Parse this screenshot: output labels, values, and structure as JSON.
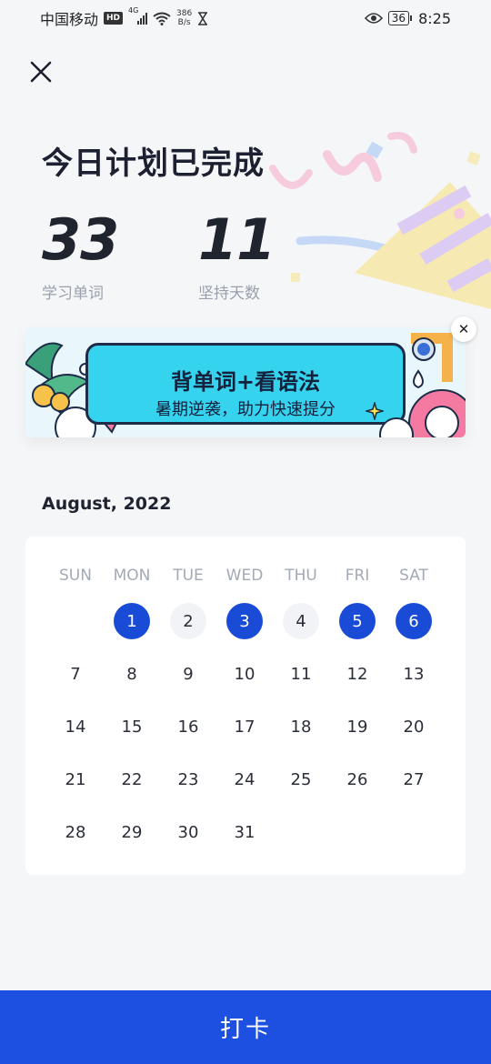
{
  "status_bar": {
    "carrier": "中国移动",
    "hd_badge": "HD",
    "signal_label": "4G",
    "net_speed_value": "386",
    "net_speed_unit": "B/s",
    "battery": "36",
    "time": "8:25"
  },
  "header": {
    "title": "今日计划已完成",
    "stats": [
      {
        "value": "33",
        "label": "学习单词"
      },
      {
        "value": "11",
        "label": "坚持天数"
      }
    ]
  },
  "banner": {
    "title": "背单词+看语法",
    "subtitle": "暑期逆袭，助力快速提分",
    "close_symbol": "✕"
  },
  "calendar": {
    "month_label": "August, 2022",
    "weekdays": [
      "SUN",
      "MON",
      "TUE",
      "WED",
      "THU",
      "FRI",
      "SAT"
    ],
    "leading_blanks": 1,
    "days": [
      {
        "d": "1",
        "state": "done"
      },
      {
        "d": "2",
        "state": "miss"
      },
      {
        "d": "3",
        "state": "done"
      },
      {
        "d": "4",
        "state": "miss"
      },
      {
        "d": "5",
        "state": "done"
      },
      {
        "d": "6",
        "state": "done"
      },
      {
        "d": "7",
        "state": ""
      },
      {
        "d": "8",
        "state": ""
      },
      {
        "d": "9",
        "state": ""
      },
      {
        "d": "10",
        "state": ""
      },
      {
        "d": "11",
        "state": ""
      },
      {
        "d": "12",
        "state": ""
      },
      {
        "d": "13",
        "state": ""
      },
      {
        "d": "14",
        "state": ""
      },
      {
        "d": "15",
        "state": ""
      },
      {
        "d": "16",
        "state": ""
      },
      {
        "d": "17",
        "state": ""
      },
      {
        "d": "18",
        "state": ""
      },
      {
        "d": "19",
        "state": ""
      },
      {
        "d": "20",
        "state": ""
      },
      {
        "d": "21",
        "state": ""
      },
      {
        "d": "22",
        "state": ""
      },
      {
        "d": "23",
        "state": ""
      },
      {
        "d": "24",
        "state": ""
      },
      {
        "d": "25",
        "state": ""
      },
      {
        "d": "26",
        "state": ""
      },
      {
        "d": "27",
        "state": ""
      },
      {
        "d": "28",
        "state": ""
      },
      {
        "d": "29",
        "state": ""
      },
      {
        "d": "30",
        "state": ""
      },
      {
        "d": "31",
        "state": ""
      }
    ]
  },
  "checkin_button": {
    "label": "打卡"
  },
  "colors": {
    "accent": "#1d4fe0",
    "done_day": "#1a4bd6",
    "banner_card": "#36d3ef"
  }
}
